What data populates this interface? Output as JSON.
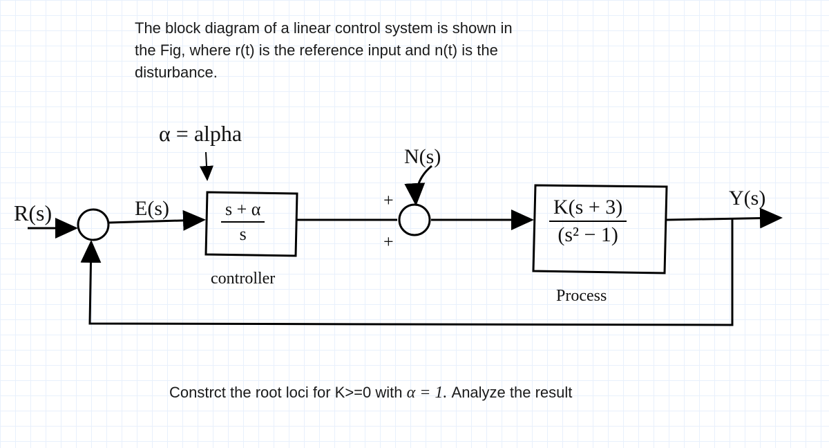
{
  "problem": {
    "line1": "The block diagram of a linear control system is shown in",
    "line2": "the Fig, where r(t) is the reference input and n(t) is the",
    "line3": "disturbance."
  },
  "annotations": {
    "alpha_def": "α = alpha",
    "controller_label": "controller",
    "process_label": "Process"
  },
  "signals": {
    "r": "R(s)",
    "e": "E(s)",
    "n": "N(s)",
    "y": "Y(s)"
  },
  "blocks": {
    "controller": {
      "num": "s + α",
      "den": "s"
    },
    "process": {
      "num": "K(s + 3)",
      "den": "(s² − 1)"
    }
  },
  "summing": {
    "plus_top": "+",
    "plus_left": "+"
  },
  "question": {
    "before": "Constrct the root loci for K>=0 with ",
    "alpha_eq": "α = 1.",
    "after": " Analyze the result"
  },
  "chart_data": {
    "type": "block-diagram",
    "nodes": [
      {
        "id": "input",
        "label": "R(s)",
        "type": "signal"
      },
      {
        "id": "sum1",
        "type": "summing-junction",
        "inputs": [
          "+R(s)",
          "-Y(s)"
        ]
      },
      {
        "id": "controller",
        "type": "transfer-function",
        "numerator": "s + α",
        "denominator": "s",
        "label": "controller"
      },
      {
        "id": "sum2",
        "type": "summing-junction",
        "inputs": [
          "+controller_out",
          "+N(s)"
        ]
      },
      {
        "id": "process",
        "type": "transfer-function",
        "numerator": "K(s + 3)",
        "denominator": "s² − 1",
        "label": "Process"
      },
      {
        "id": "output",
        "label": "Y(s)",
        "type": "signal"
      },
      {
        "id": "disturbance",
        "label": "N(s)",
        "type": "signal"
      }
    ],
    "edges": [
      [
        "input",
        "sum1"
      ],
      [
        "sum1",
        "controller",
        "E(s)"
      ],
      [
        "controller",
        "sum2"
      ],
      [
        "disturbance",
        "sum2"
      ],
      [
        "sum2",
        "process"
      ],
      [
        "process",
        "output"
      ],
      [
        "output",
        "sum1",
        "feedback"
      ]
    ],
    "parameters": {
      "alpha": 1,
      "K_range": "K >= 0"
    }
  }
}
